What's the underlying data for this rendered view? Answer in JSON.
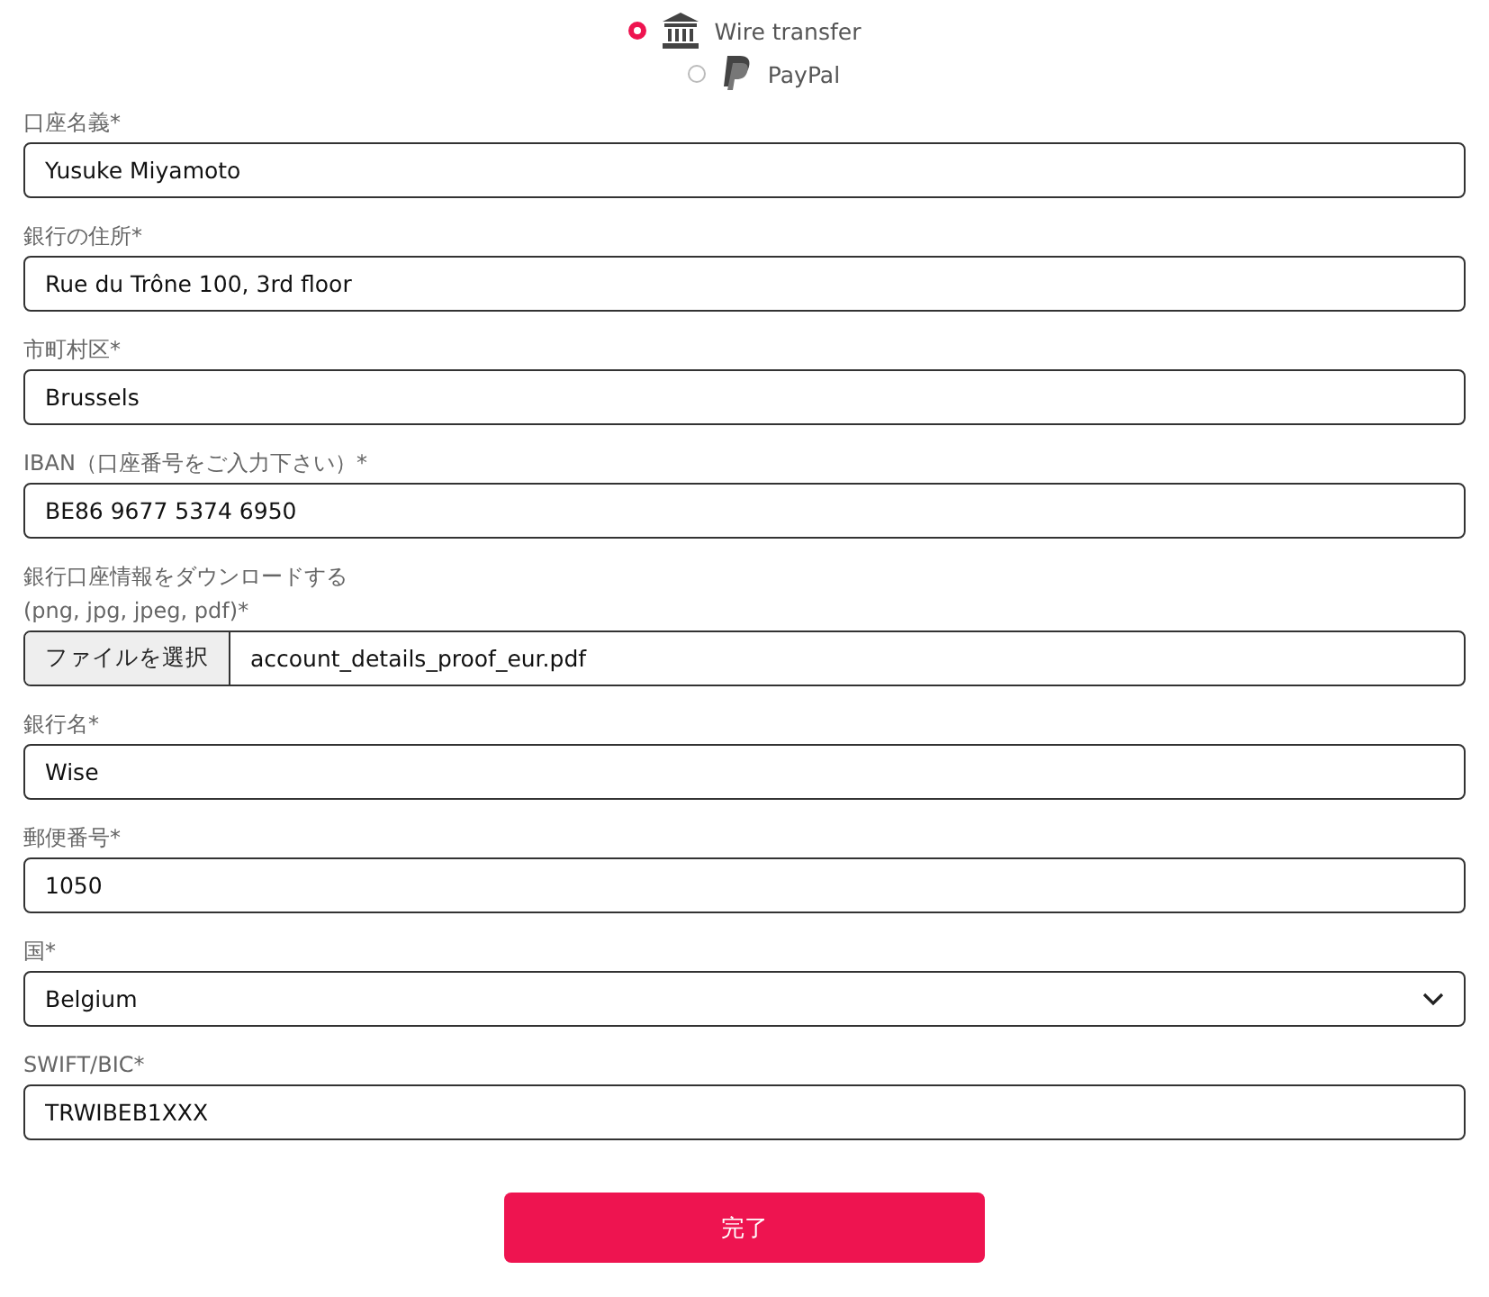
{
  "payment_methods": [
    {
      "label": "Wire transfer",
      "kind": "bank",
      "selected": true
    },
    {
      "label": "PayPal",
      "kind": "paypal",
      "selected": false
    }
  ],
  "fields": [
    {
      "kind": "text",
      "label": "口座名義*",
      "value": "Yusuke Miyamoto"
    },
    {
      "kind": "text",
      "label": "銀行の住所*",
      "value": "Rue du Trône 100, 3rd floor"
    },
    {
      "kind": "text",
      "label": "市町村区*",
      "value": "Brussels"
    },
    {
      "kind": "text",
      "label": "IBAN（口座番号をご入力下さい）*",
      "value": "BE86 9677 5374 6950"
    },
    {
      "kind": "file",
      "label": "銀行口座情報をダウンロードする",
      "label_line_2": "(png, jpg, jpeg, pdf)*",
      "button": "ファイルを選択",
      "value": "account_details_proof_eur.pdf"
    },
    {
      "kind": "text",
      "label": "銀行名*",
      "value": "Wise"
    },
    {
      "kind": "text",
      "label": "郵便番号*",
      "value": "1050"
    },
    {
      "kind": "select",
      "label": "国*",
      "value": "Belgium"
    },
    {
      "kind": "text",
      "label": "SWIFT/BIC*",
      "value": "TRWIBEB1XXX"
    }
  ],
  "submit": "完了"
}
